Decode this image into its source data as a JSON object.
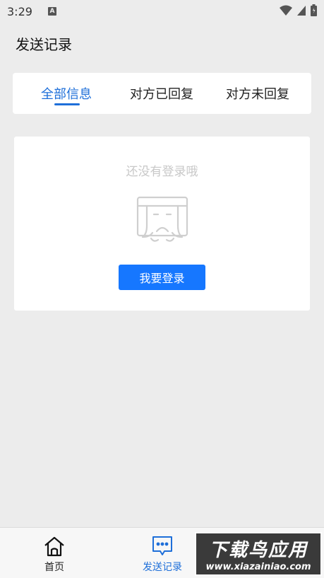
{
  "status_bar": {
    "time": "3:29",
    "notification_letter": "A",
    "icons": [
      "wifi-icon",
      "signal-icon",
      "battery-icon"
    ]
  },
  "page": {
    "title": "发送记录"
  },
  "tabs": [
    {
      "label": "全部信息",
      "active": true
    },
    {
      "label": "对方已回复",
      "active": false
    },
    {
      "label": "对方未回复",
      "active": false
    }
  ],
  "empty_state": {
    "message": "还没有登录哦",
    "illustration": "crying-face-icon",
    "login_button": "我要登录"
  },
  "bottom_nav": [
    {
      "label": "首页",
      "icon": "home-icon",
      "active": false
    },
    {
      "label": "发送记录",
      "icon": "chat-icon",
      "active": true
    },
    {
      "label": "",
      "icon": "profile-icon",
      "active": false
    }
  ],
  "watermark": {
    "title": "下载鸟应用",
    "url": "www.xiazainiao.com"
  },
  "colors": {
    "accent": "#1e6fd9",
    "button": "#1677ff",
    "background": "#ececec",
    "card": "#ffffff",
    "muted_text": "#c8c8c8"
  }
}
